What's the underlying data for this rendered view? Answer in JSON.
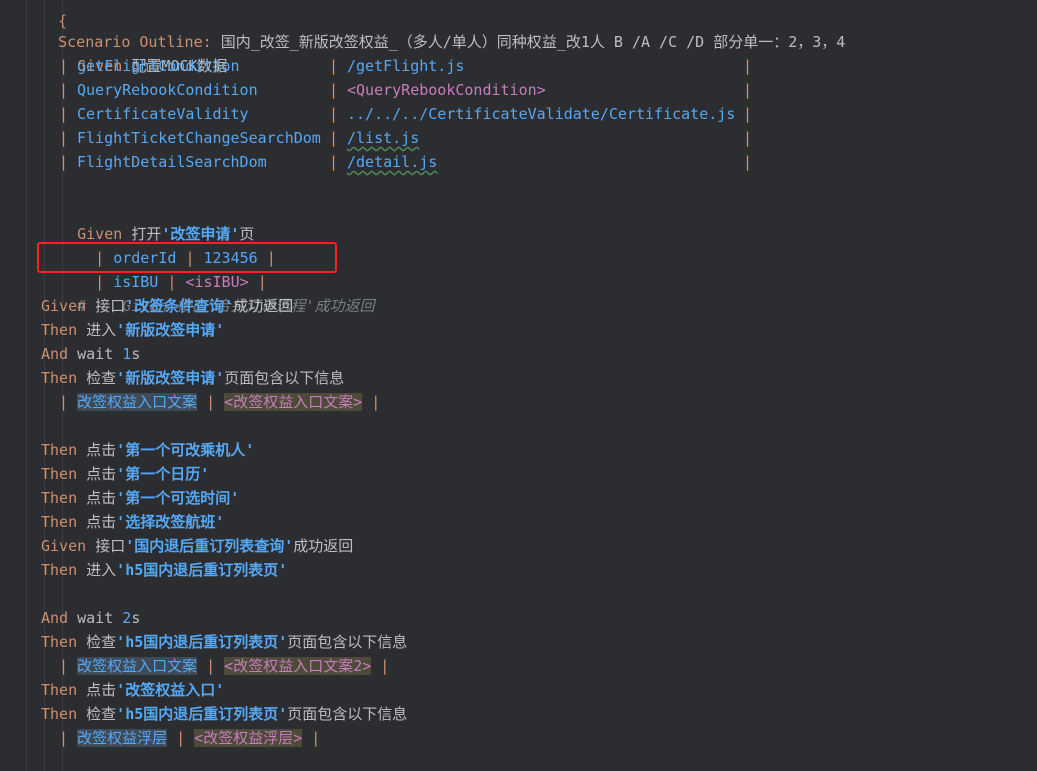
{
  "top_fragment": "{",
  "scenario": {
    "keyword": "Scenario Outline:",
    "title": "国内_改签_新版改签权益_（多人/单人）同种权益_改1人 B /A /C /D 部分单一：2，3，4"
  },
  "step1": {
    "keyword": "Given",
    "text": "配置MOCK数据"
  },
  "mock_table": [
    {
      "name": "getFlightCondition",
      "value": "/getFlight.js"
    },
    {
      "name": "QueryRebookCondition",
      "value": "<QueryRebookCondition>"
    },
    {
      "name": "CertificateValidity",
      "value": "../../../CertificateValidate/Certificate.js"
    },
    {
      "name": "FlightTicketChangeSearchDom",
      "value": "/list.js"
    },
    {
      "name": "FlightDetailSearchDom",
      "value": "/detail.js"
    }
  ],
  "step2": {
    "keyword": "Given",
    "prefix": "打开",
    "quoted": "'改签申请'",
    "suffix": "页"
  },
  "param_rows": [
    {
      "key": "orderId",
      "value": "123456"
    },
    {
      "key": "isIBU",
      "value": "<isIBU>"
    }
  ],
  "comment_line": "#    Given 接口'合并订单选程'成功返回",
  "steps_a": [
    {
      "keyword": "Given",
      "prefix": "接口",
      "quoted": "'改签条件查询'",
      "suffix": "成功返回"
    },
    {
      "keyword": "Then",
      "prefix": "进入",
      "quoted": "'新版改签申请'",
      "suffix": ""
    },
    {
      "keyword": "And",
      "prefix": "wait ",
      "num": "1",
      "suffix": "s"
    },
    {
      "keyword": "Then",
      "prefix": "检查",
      "quoted": "'新版改签申请'",
      "suffix": "页面包含以下信息"
    }
  ],
  "table_a": {
    "left": "改签权益入口文案",
    "right": "<改签权益入口文案>"
  },
  "steps_b": [
    {
      "keyword": "Then",
      "prefix": "点击",
      "quoted": "'第一个可改乘机人'",
      "suffix": ""
    },
    {
      "keyword": "Then",
      "prefix": "点击",
      "quoted": "'第一个日历'",
      "suffix": ""
    },
    {
      "keyword": "Then",
      "prefix": "点击",
      "quoted": "'第一个可选时间'",
      "suffix": ""
    },
    {
      "keyword": "Then",
      "prefix": "点击",
      "quoted": "'选择改签航班'",
      "suffix": ""
    },
    {
      "keyword": "Given",
      "prefix": "接口",
      "quoted": "'国内退后重订列表查询'",
      "suffix": "成功返回"
    },
    {
      "keyword": "Then",
      "prefix": "进入",
      "quoted": "'h5国内退后重订列表页'",
      "suffix": ""
    }
  ],
  "steps_c": [
    {
      "keyword": "And",
      "prefix": "wait ",
      "num": "2",
      "suffix": "s"
    },
    {
      "keyword": "Then",
      "prefix": "检查",
      "quoted": "'h5国内退后重订列表页'",
      "suffix": "页面包含以下信息"
    }
  ],
  "table_b": {
    "left": "改签权益入口文案",
    "right": "<改签权益入口文案2>"
  },
  "steps_d": [
    {
      "keyword": "Then",
      "prefix": "点击",
      "quoted": "'改签权益入口'",
      "suffix": ""
    },
    {
      "keyword": "Then",
      "prefix": "检查",
      "quoted": "'h5国内退后重订列表页'",
      "suffix": "页面包含以下信息"
    }
  ],
  "table_c": {
    "left": "改签权益浮层",
    "right": "<改签权益浮层>"
  },
  "pipe_char": "|",
  "colors": {
    "background": "#2b2d30",
    "keyword": "#cf8e6d",
    "string": "#56a8f5",
    "placeholder": "#c77dbb",
    "comment": "#7a7e85",
    "highlight_box": "#ff1f1f"
  }
}
